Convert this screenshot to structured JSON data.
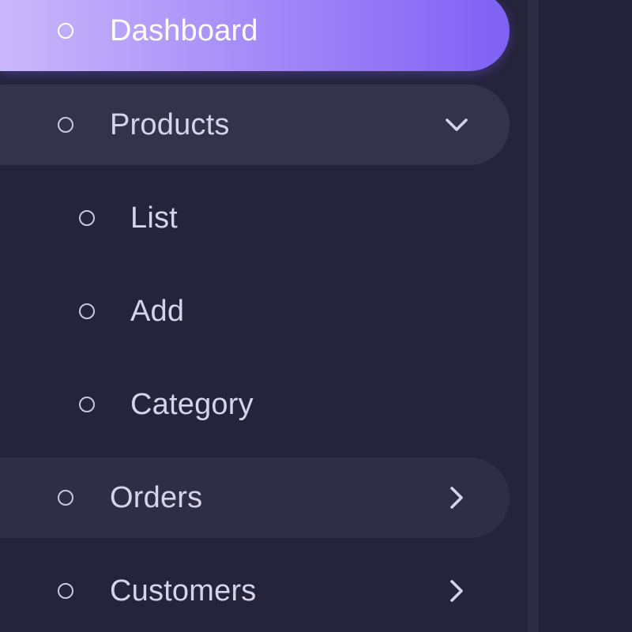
{
  "colors": {
    "sidebar_bg": "#26243b",
    "active_gradient_start": "#c9b8fb",
    "active_gradient_end": "#7f61f5",
    "open_item_bg": "#35334c",
    "text": "#d6d4e8"
  },
  "sidebar": {
    "items": [
      {
        "label": "Dashboard",
        "icon": "circle-icon",
        "state": "active"
      },
      {
        "label": "Products",
        "icon": "circle-icon",
        "state": "expanded",
        "chevron": "chevron-down-icon",
        "children": [
          {
            "label": "List",
            "icon": "circle-icon"
          },
          {
            "label": "Add",
            "icon": "circle-icon"
          },
          {
            "label": "Category",
            "icon": "circle-icon"
          }
        ]
      },
      {
        "label": "Orders",
        "icon": "circle-icon",
        "state": "collapsed",
        "chevron": "chevron-right-icon"
      },
      {
        "label": "Customers",
        "icon": "circle-icon",
        "state": "collapsed",
        "chevron": "chevron-right-icon"
      }
    ]
  }
}
